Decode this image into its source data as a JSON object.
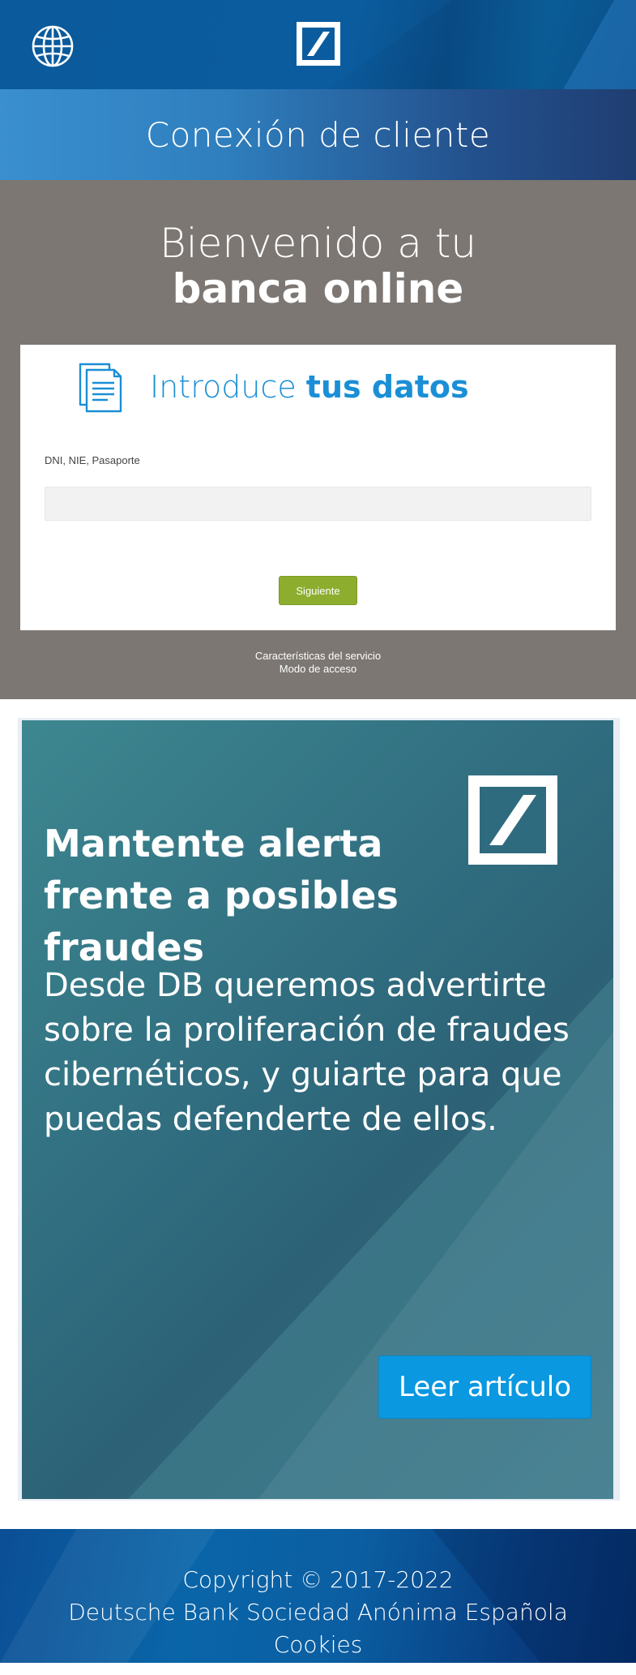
{
  "header": {
    "globe_icon": "globe-icon",
    "logo_icon": "deutsche-bank-logo"
  },
  "title_band": {
    "title": "Conexión de cliente"
  },
  "welcome": {
    "line1": "Bienvenido a tu",
    "line2": "banca online"
  },
  "login_card": {
    "icon": "document-icon",
    "title_light": "Introduce ",
    "title_bold": "tus datos",
    "field_label": "DNI, NIE, Pasaporte",
    "field_value": "",
    "field_placeholder": "",
    "next_button": "Siguiente"
  },
  "service_links": {
    "features": "Características del servicio",
    "access_mode": "Modo de acceso"
  },
  "promo": {
    "heading_line1": "Mantente alerta",
    "heading_line2": "frente a posibles fraudes",
    "text": "Desde DB queremos advertirte sobre la proliferación de fraudes cibernéticos, y guiarte para que puedas defenderte de ellos.",
    "button": "Leer artículo"
  },
  "footer": {
    "copyright": "Copyright © 2017-2022",
    "company": "Deutsche Bank Sociedad Anónima Española",
    "cookies": "Cookies"
  },
  "colors": {
    "header_blue": "#0b5c9e",
    "grey_area": "#7c7773",
    "accent_blue": "#1a8fd6",
    "button_green": "#8cad2e",
    "promo_teal": "#2f6b7e",
    "read_button_blue": "#0a98e0"
  }
}
